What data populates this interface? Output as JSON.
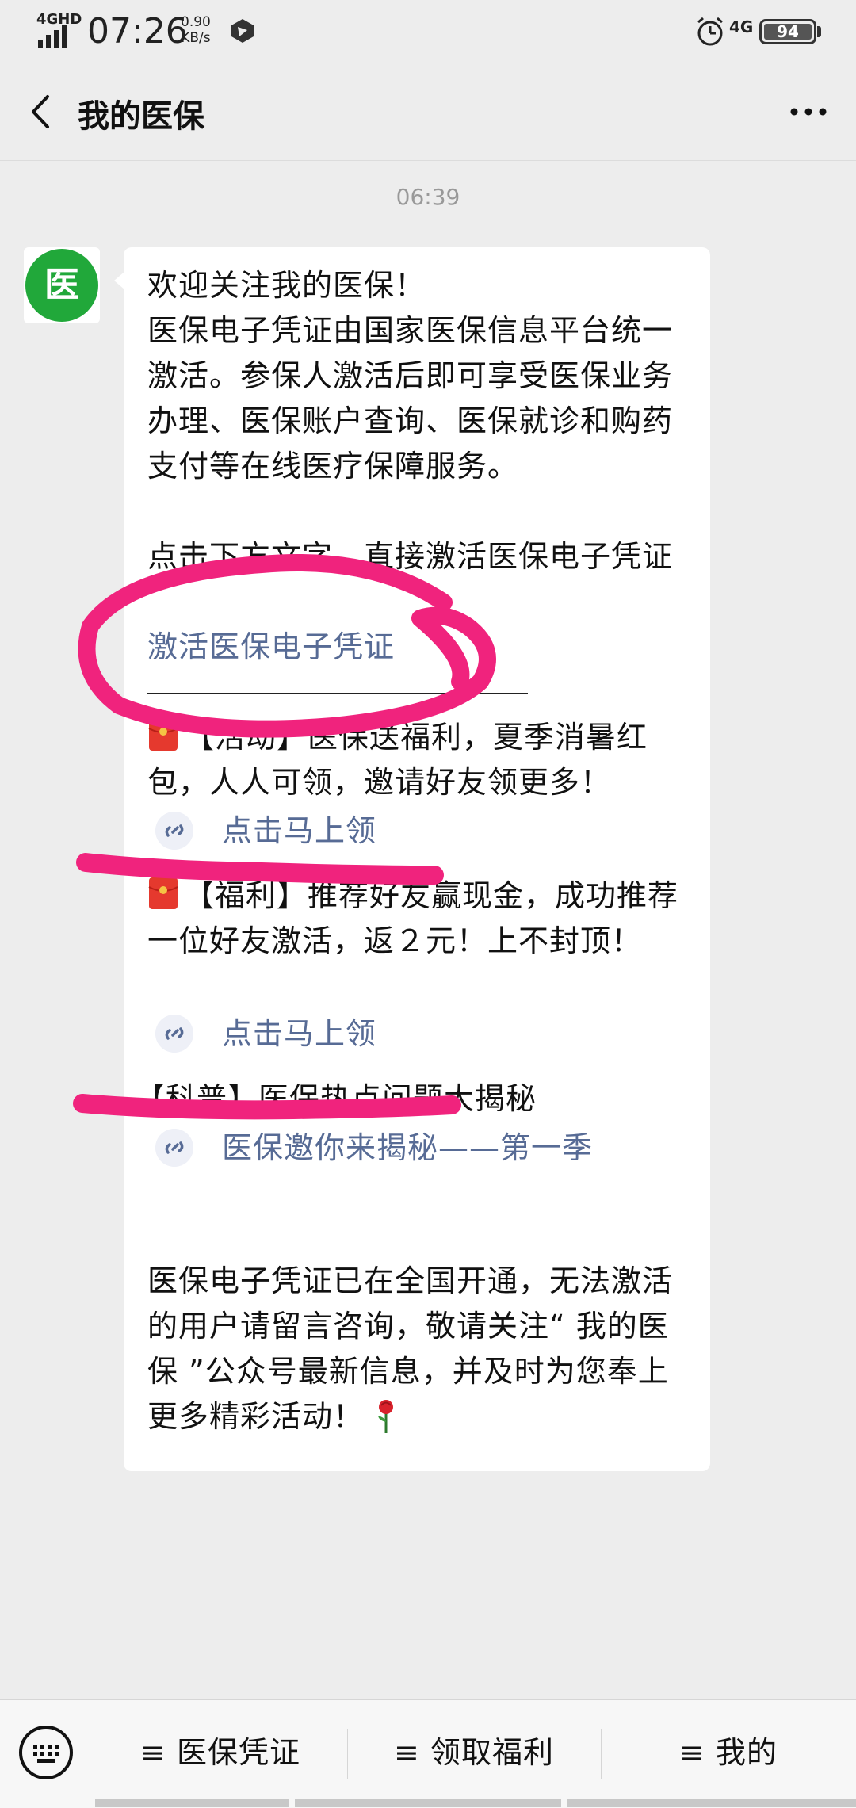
{
  "status_bar": {
    "network": "4GHD",
    "time": "07:26",
    "speed_value": "0.90",
    "speed_unit": "KB/s",
    "mobile": "4G",
    "battery": "94"
  },
  "header": {
    "title": "我的医保"
  },
  "chat": {
    "timestamp": "06:39",
    "avatar_char": "医",
    "welcome": "欢迎关注我的医保！",
    "intro": "医保电子凭证由国家医保信息平台统一激活。参保人激活后即可享受医保业务办理、医保账户查询、医保就诊和购药支付等在线医疗保障服务。",
    "click_hint": "点击下方文字，直接激活医保电子凭证",
    "activate_link": "激活医保电子凭证",
    "activity_text": "【活动】医保送福利，夏季消暑红包，人人可领，邀请好友领更多！",
    "activity_link": "点击马上领",
    "welfare_text": "【福利】推荐好友赢现金，成功推荐一位好友激活，返２元！上不封顶！",
    "welfare_link": "点击马上领",
    "science_text": "【科普】医保热点问题大揭秘",
    "science_link": "医保邀你来揭秘——第一季",
    "closing_text": "医保电子凭证已在全国开通，无法激活的用户请留言咨询，敬请关注“ 我的医保 ”公众号最新信息，并及时为您奉上更多精彩活动！"
  },
  "bottom_menu": {
    "items": [
      {
        "label": "≡ 医保凭证"
      },
      {
        "label": "≡ 领取福利"
      },
      {
        "label": "≡ 我的"
      }
    ]
  },
  "colors": {
    "accent_link": "#576b95",
    "avatar_green": "#21a83a",
    "annotation_pink": "#f0237d"
  }
}
